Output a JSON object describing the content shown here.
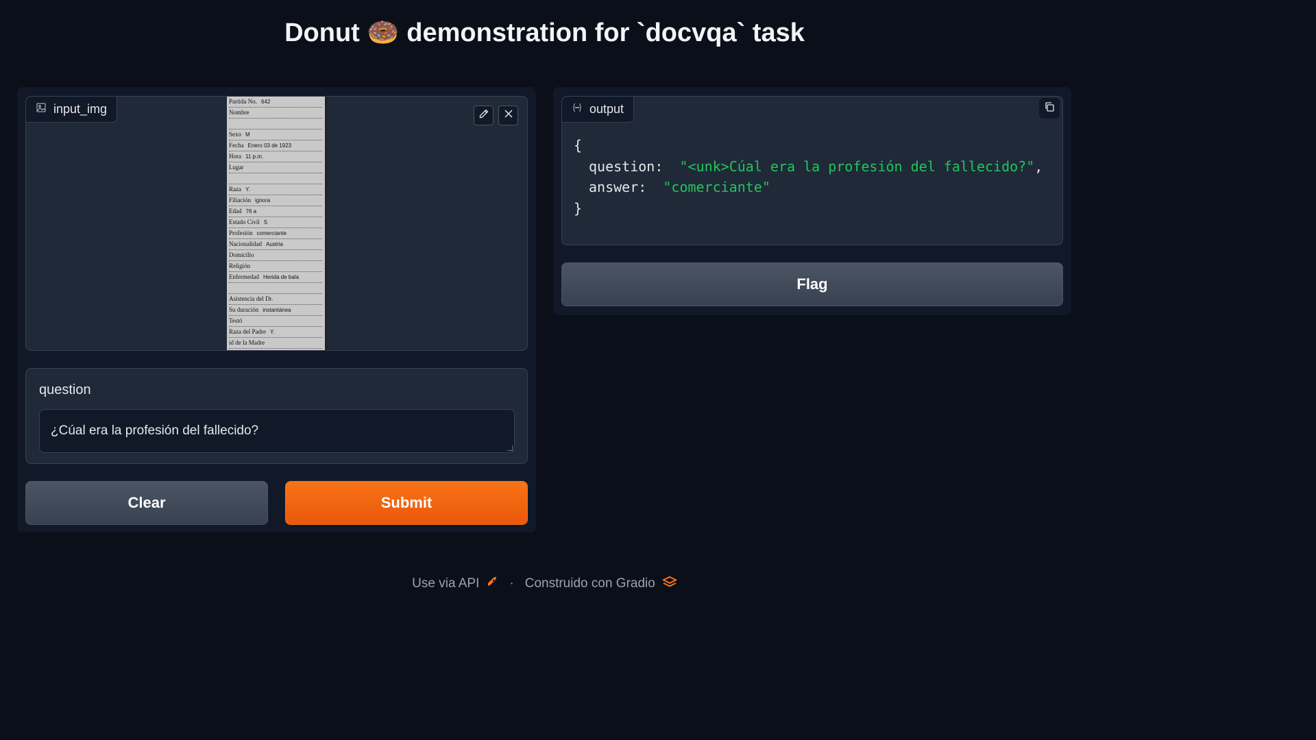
{
  "header": {
    "title": "Donut 🍩 demonstration for `docvqa` task"
  },
  "input_image": {
    "label": "input_img",
    "document_rows": [
      {
        "field": "Partida No.",
        "value": "642"
      },
      {
        "field": "Nombre",
        "value": ""
      },
      {
        "field": "",
        "value": ""
      },
      {
        "field": "Sexo",
        "value": "M"
      },
      {
        "field": "Fecha",
        "value": "Enero 03 de 1923"
      },
      {
        "field": "Hora",
        "value": "11 p.m."
      },
      {
        "field": "Lugar",
        "value": ""
      },
      {
        "field": "",
        "value": ""
      },
      {
        "field": "Raza",
        "value": "Y."
      },
      {
        "field": "Filiación",
        "value": "ignora"
      },
      {
        "field": "Edad",
        "value": "76 a"
      },
      {
        "field": "Estado Civil",
        "value": "S"
      },
      {
        "field": "Profesión",
        "value": "comerciante"
      },
      {
        "field": "Nacionalidad",
        "value": "Austria"
      },
      {
        "field": "Domicilio",
        "value": ""
      },
      {
        "field": "Religión",
        "value": ""
      },
      {
        "field": "Enfermedad",
        "value": "Herida de bala"
      },
      {
        "field": "",
        "value": ""
      },
      {
        "field": "Asistencia del Dr.",
        "value": ""
      },
      {
        "field": "Su duración",
        "value": "instantánea"
      },
      {
        "field": "Testó",
        "value": ""
      },
      {
        "field": "Raza del Padre",
        "value": "Y."
      },
      {
        "field": "id de la Madre",
        "value": ""
      }
    ]
  },
  "question": {
    "label": "question",
    "value": "¿Cúal era la profesión del fallecido?"
  },
  "buttons": {
    "clear": "Clear",
    "submit": "Submit",
    "flag": "Flag"
  },
  "output": {
    "label": "output",
    "open_brace": "{",
    "close_brace": "}",
    "question_key": "question:",
    "question_value": "\"<unk>Cúal era la profesión del fallecido?\"",
    "question_comma": ",",
    "answer_key": "answer:",
    "answer_value": "\"comerciante\""
  },
  "footer": {
    "api_link": "Use via API",
    "separator": "·",
    "built_with": "Construido con Gradio"
  },
  "colors": {
    "accent": "#f97316",
    "background": "#0b0f19",
    "json_string": "#22c55e"
  }
}
